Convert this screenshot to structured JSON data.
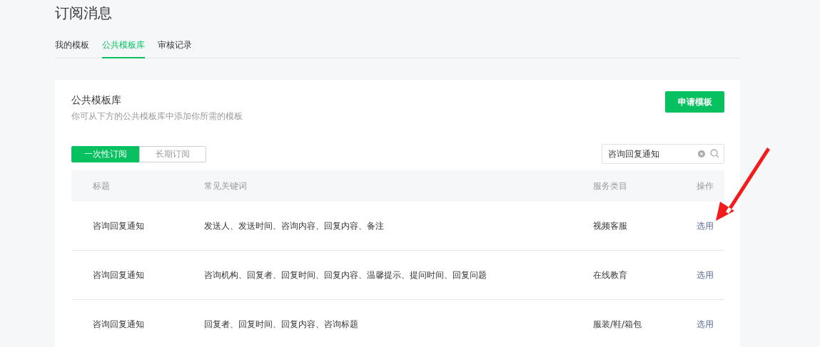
{
  "page_title": "订阅消息",
  "tabs": [
    {
      "label": "我的模板",
      "selected": false
    },
    {
      "label": "公共模板库",
      "selected": true
    },
    {
      "label": "审核记录",
      "selected": false
    }
  ],
  "card": {
    "title": "公共模板库",
    "subtitle": "你可从下方的公共模板库中添加你所需的模板",
    "apply_button": "申请模板"
  },
  "segments": [
    {
      "label": "一次性订阅",
      "selected": true
    },
    {
      "label": "长期订阅",
      "selected": false
    }
  ],
  "search": {
    "value": "咨询回复通知"
  },
  "table": {
    "columns": [
      "标题",
      "常见关键词",
      "服务类目",
      "操作"
    ],
    "rows": [
      {
        "title": "咨询回复通知",
        "keywords": "发送人、发送时间、咨询内容、回复内容、备注",
        "category": "视频客服",
        "action": "选用"
      },
      {
        "title": "咨询回复通知",
        "keywords": "咨询机构、回复者、回复时间、回复内容、温馨提示、提问时间、回复问题",
        "category": "在线教育",
        "action": "选用"
      },
      {
        "title": "咨询回复通知",
        "keywords": "回复者、回复时间、回复内容、咨询标题",
        "category": "服装/鞋/箱包",
        "action": "选用"
      }
    ]
  }
}
